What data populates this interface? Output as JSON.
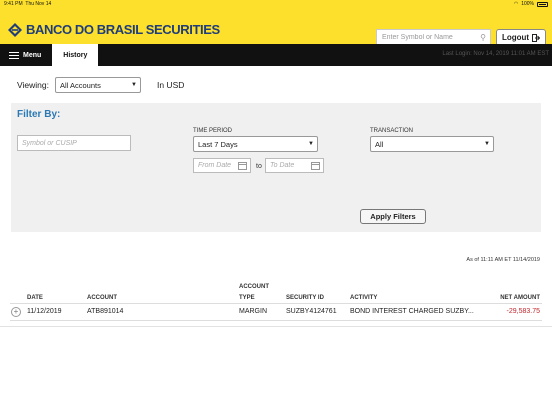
{
  "status_bar": {
    "time": "9:41 PM",
    "date": "Thu Nov 14",
    "battery": "100%"
  },
  "header": {
    "brand": "BANCO DO BRASIL SECURITIES",
    "search_placeholder": "Enter Symbol or Name",
    "logout_label": "Logout"
  },
  "nav": {
    "menu_label": "Menu",
    "active_tab": "History",
    "last_login": "Last Login: Nov 14, 2019 11:01 AM EST"
  },
  "viewing": {
    "label": "Viewing:",
    "account_selected": "All Accounts",
    "currency": "In USD"
  },
  "filter": {
    "title": "Filter By:",
    "symbol_placeholder": "Symbol or CUSIP",
    "time_period_label": "TIME PERIOD",
    "time_period_value": "Last 7 Days",
    "from_placeholder": "From Date",
    "to_label": "to",
    "to_placeholder": "To Date",
    "transaction_label": "TRANSACTION",
    "transaction_value": "All",
    "apply_label": "Apply Filters"
  },
  "as_of": "As of 11:11 AM ET 11/14/2019",
  "table": {
    "headers": {
      "date": "DATE",
      "account": "ACCOUNT",
      "account_type_1": "ACCOUNT",
      "account_type_2": "TYPE",
      "security_id": "SECURITY ID",
      "activity": "ACTIVITY",
      "net_amount": "NET AMOUNT"
    },
    "rows": [
      {
        "date": "11/12/2019",
        "account": "ATB891014",
        "account_type": "MARGIN",
        "security_id": "SUZBY4124761",
        "activity": "BOND INTEREST CHARGED SUZBY...",
        "net_amount": "-29,583.75"
      }
    ]
  },
  "colors": {
    "brand_yellow": "#fde02c",
    "brand_blue": "#1f3d7a",
    "accent_blue": "#2b78b5",
    "negative_red": "#c0272d"
  }
}
